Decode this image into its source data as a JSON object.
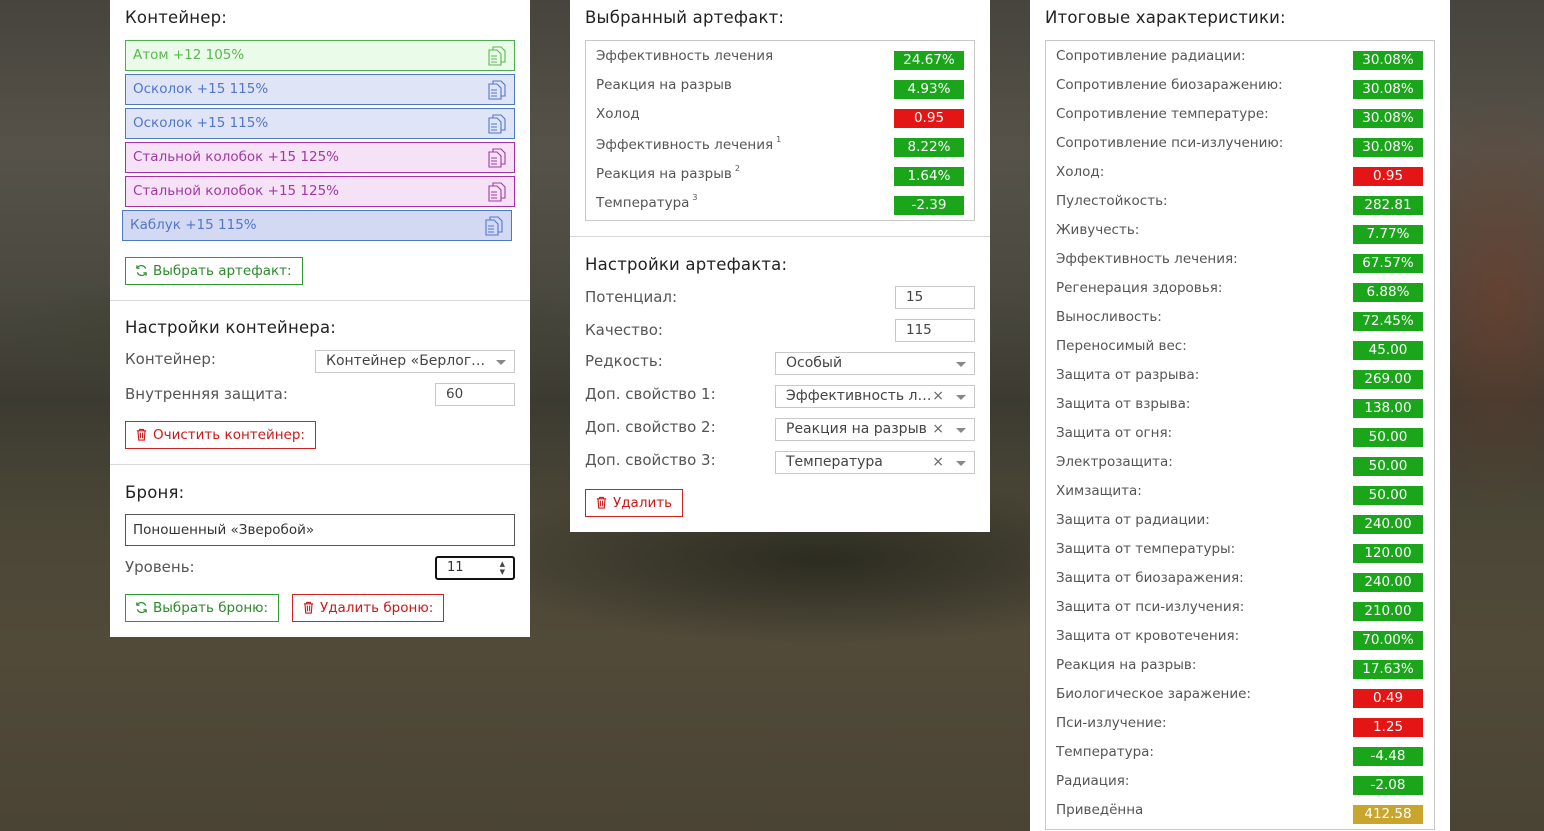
{
  "container_section": {
    "title": "Контейнер:",
    "slots": [
      {
        "label": "Атом +12 105%",
        "color": "green",
        "icon": "copy-icon"
      },
      {
        "label": "Осколок +15 115%",
        "color": "blue",
        "icon": "copy-icon"
      },
      {
        "label": "Осколок +15 115%",
        "color": "blue",
        "icon": "copy-icon"
      },
      {
        "label": "Стальной колобок +15 125%",
        "color": "purple",
        "icon": "copy-icon"
      },
      {
        "label": "Стальной колобок +15 125%",
        "color": "purple",
        "icon": "copy-icon"
      },
      {
        "label": "Каблук +15 115%",
        "color": "blue",
        "icon": "copy-icon"
      }
    ],
    "select_artifact_button": "Выбрать артефакт:"
  },
  "container_settings": {
    "title": "Настройки контейнера:",
    "container_label": "Контейнер:",
    "container_value": "Контейнер «Берлога…",
    "inner_protection_label": "Внутренняя защита:",
    "inner_protection_value": "60",
    "clear_button": "Очистить контейнер:"
  },
  "armor": {
    "title": "Броня:",
    "name": "Поношенный «Зверобой»",
    "level_label": "Уровень:",
    "level_value": "11",
    "select_button": "Выбрать броню:",
    "delete_button": "Удалить броню:"
  },
  "selected_artifact": {
    "title": "Выбранный артефакт:",
    "rows": [
      {
        "label": "Эффективность лечения",
        "sup": "",
        "value": "24.67%",
        "color": "green"
      },
      {
        "label": "Реакция на разрыв",
        "sup": "",
        "value": "4.93%",
        "color": "green"
      },
      {
        "label": "Холод",
        "sup": "",
        "value": "0.95",
        "color": "red"
      },
      {
        "label": "Эффективность лечения",
        "sup": "1",
        "value": "8.22%",
        "color": "green"
      },
      {
        "label": "Реакция на разрыв",
        "sup": "2",
        "value": "1.64%",
        "color": "green"
      },
      {
        "label": "Температура",
        "sup": "3",
        "value": "-2.39",
        "color": "green"
      }
    ]
  },
  "artifact_settings": {
    "title": "Настройки артефакта:",
    "potential_label": "Потенциал:",
    "potential_value": "15",
    "quality_label": "Качество:",
    "quality_value": "115",
    "rarity_label": "Редкость:",
    "rarity_value": "Особый",
    "prop1_label": "Доп. свойство 1:",
    "prop1_value": "Эффективность ле…",
    "prop2_label": "Доп. свойство 2:",
    "prop2_value": "Реакция на разрыв",
    "prop3_label": "Доп. свойство 3:",
    "prop3_value": "Температура",
    "clear_symbol": "×",
    "delete_button": "Удалить"
  },
  "totals": {
    "title": "Итоговые характеристики:",
    "rows": [
      {
        "label": "Сопротивление радиации:",
        "value": "30.08%",
        "color": "green"
      },
      {
        "label": "Сопротивление биозаражению:",
        "value": "30.08%",
        "color": "green"
      },
      {
        "label": "Сопротивление температуре:",
        "value": "30.08%",
        "color": "green"
      },
      {
        "label": "Сопротивление пси-излучению:",
        "value": "30.08%",
        "color": "green"
      },
      {
        "label": "Холод:",
        "value": "0.95",
        "color": "red"
      },
      {
        "label": "Пулестойкость:",
        "value": "282.81",
        "color": "green"
      },
      {
        "label": "Живучесть:",
        "value": "7.77%",
        "color": "green"
      },
      {
        "label": "Эффективность лечения:",
        "value": "67.57%",
        "color": "green"
      },
      {
        "label": "Регенерация здоровья:",
        "value": "6.88%",
        "color": "green"
      },
      {
        "label": "Выносливость:",
        "value": "72.45%",
        "color": "green"
      },
      {
        "label": "Переносимый вес:",
        "value": "45.00",
        "color": "green"
      },
      {
        "label": "Защита от разрыва:",
        "value": "269.00",
        "color": "green"
      },
      {
        "label": "Защита от взрыва:",
        "value": "138.00",
        "color": "green"
      },
      {
        "label": "Защита от огня:",
        "value": "50.00",
        "color": "green"
      },
      {
        "label": "Электрозащита:",
        "value": "50.00",
        "color": "green"
      },
      {
        "label": "Химзащита:",
        "value": "50.00",
        "color": "green"
      },
      {
        "label": "Защита от радиации:",
        "value": "240.00",
        "color": "green"
      },
      {
        "label": "Защита от температуры:",
        "value": "120.00",
        "color": "green"
      },
      {
        "label": "Защита от биозаражения:",
        "value": "240.00",
        "color": "green"
      },
      {
        "label": "Защита от пси-излучения:",
        "value": "210.00",
        "color": "green"
      },
      {
        "label": "Защита от кровотечения:",
        "value": "70.00%",
        "color": "green"
      },
      {
        "label": "Реакция на разрыв:",
        "value": "17.63%",
        "color": "green"
      },
      {
        "label": "Биологическое заражение:",
        "value": "0.49",
        "color": "red"
      },
      {
        "label": "Пси-излучение:",
        "value": "1.25",
        "color": "red"
      },
      {
        "label": "Температура:",
        "value": "-4.48",
        "color": "green"
      },
      {
        "label": "Радиация:",
        "value": "-2.08",
        "color": "green"
      },
      {
        "label": "Приведённа",
        "value": "412.58",
        "color": "gold"
      }
    ]
  },
  "colors": {
    "green": "#1aa51a",
    "red": "#e41515",
    "gold": "#c8a52c"
  }
}
